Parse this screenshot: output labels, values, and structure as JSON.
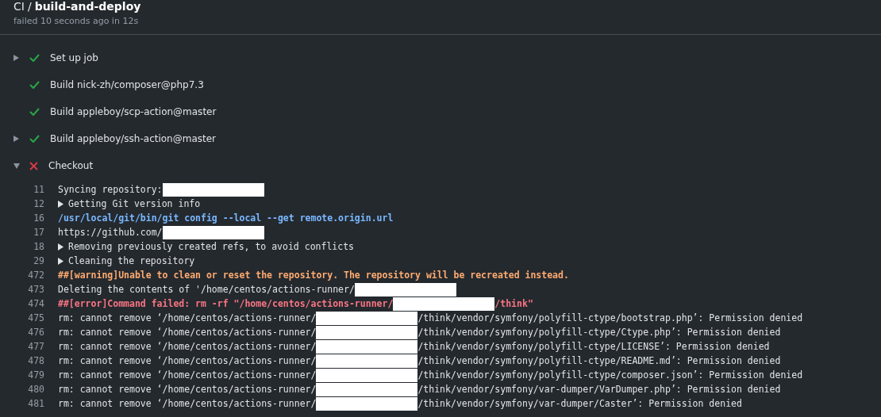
{
  "header": {
    "workflow": "CI",
    "separator": "/",
    "job": "build-and-deploy",
    "status_line": "failed 10 seconds ago in 12s"
  },
  "steps": [
    {
      "name": "Set up job",
      "passed": true,
      "expanded": false
    },
    {
      "name": "Build nick-zh/composer@php7.3",
      "passed": true
    },
    {
      "name": "Build appleboy/scp-action@master",
      "passed": true
    },
    {
      "name": "Build appleboy/ssh-action@master",
      "passed": true,
      "expanded": false
    },
    {
      "name": "Checkout",
      "passed": false,
      "expanded": true,
      "log": [
        {
          "number": "11",
          "kind": "plain",
          "segments": [
            {
              "kind": "text",
              "text": "Syncing repository:"
            },
            {
              "kind": "redaction"
            }
          ]
        },
        {
          "number": "12",
          "kind": "group",
          "segments": [
            {
              "kind": "text",
              "text": "Getting Git version info"
            }
          ]
        },
        {
          "number": "16",
          "kind": "command",
          "segments": [
            {
              "kind": "text",
              "text": "/usr/local/git/bin/git config --local --get remote.origin.url"
            }
          ]
        },
        {
          "number": "17",
          "kind": "plain",
          "segments": [
            {
              "kind": "text",
              "text": "https://github.com/"
            },
            {
              "kind": "redaction"
            }
          ]
        },
        {
          "number": "18",
          "kind": "group",
          "segments": [
            {
              "kind": "text",
              "text": "Removing previously created refs, to avoid conflicts"
            }
          ]
        },
        {
          "number": "29",
          "kind": "group",
          "segments": [
            {
              "kind": "text",
              "text": "Cleaning the repository"
            }
          ]
        },
        {
          "number": "472",
          "kind": "warning",
          "segments": [
            {
              "kind": "text",
              "text": "##[warning]Unable to clean or reset the repository. The repository will be recreated instead."
            }
          ]
        },
        {
          "number": "473",
          "kind": "plain",
          "segments": [
            {
              "kind": "text",
              "text": "Deleting the contents of '/home/centos/actions-runner/"
            },
            {
              "kind": "redaction"
            }
          ]
        },
        {
          "number": "474",
          "kind": "error",
          "segments": [
            {
              "kind": "text",
              "text": "##[error]Command failed: rm -rf \"/home/centos/actions-runner/"
            },
            {
              "kind": "redaction"
            },
            {
              "kind": "text",
              "text": "/think\""
            }
          ]
        },
        {
          "number": "475",
          "kind": "plain",
          "segments": [
            {
              "kind": "text",
              "text": "rm: cannot remove ‘/home/centos/actions-runner/"
            },
            {
              "kind": "redaction"
            },
            {
              "kind": "text",
              "text": "/think/vendor/symfony/polyfill-ctype/bootstrap.php’: Permission denied"
            }
          ]
        },
        {
          "number": "476",
          "kind": "plain",
          "segments": [
            {
              "kind": "text",
              "text": "rm: cannot remove ‘/home/centos/actions-runner/"
            },
            {
              "kind": "redaction"
            },
            {
              "kind": "text",
              "text": "/think/vendor/symfony/polyfill-ctype/Ctype.php’: Permission denied"
            }
          ]
        },
        {
          "number": "477",
          "kind": "plain",
          "segments": [
            {
              "kind": "text",
              "text": "rm: cannot remove ‘/home/centos/actions-runner/"
            },
            {
              "kind": "redaction"
            },
            {
              "kind": "text",
              "text": "/think/vendor/symfony/polyfill-ctype/LICENSE’: Permission denied"
            }
          ]
        },
        {
          "number": "478",
          "kind": "plain",
          "segments": [
            {
              "kind": "text",
              "text": "rm: cannot remove ‘/home/centos/actions-runner/"
            },
            {
              "kind": "redaction"
            },
            {
              "kind": "text",
              "text": "/think/vendor/symfony/polyfill-ctype/README.md’: Permission denied"
            }
          ]
        },
        {
          "number": "479",
          "kind": "plain",
          "segments": [
            {
              "kind": "text",
              "text": "rm: cannot remove ‘/home/centos/actions-runner/"
            },
            {
              "kind": "redaction"
            },
            {
              "kind": "text",
              "text": "/think/vendor/symfony/polyfill-ctype/composer.json’: Permission denied"
            }
          ]
        },
        {
          "number": "480",
          "kind": "plain",
          "segments": [
            {
              "kind": "text",
              "text": "rm: cannot remove ‘/home/centos/actions-runner/"
            },
            {
              "kind": "redaction"
            },
            {
              "kind": "text",
              "text": "/think/vendor/symfony/var-dumper/VarDumper.php’: Permission denied"
            }
          ]
        },
        {
          "number": "481",
          "kind": "plain",
          "segments": [
            {
              "kind": "text",
              "text": "rm: cannot remove ‘/home/centos/actions-runner/"
            },
            {
              "kind": "redaction"
            },
            {
              "kind": "text",
              "text": "/think/vendor/symfony/var-dumper/Caster’: Permission denied"
            }
          ]
        }
      ]
    }
  ]
}
